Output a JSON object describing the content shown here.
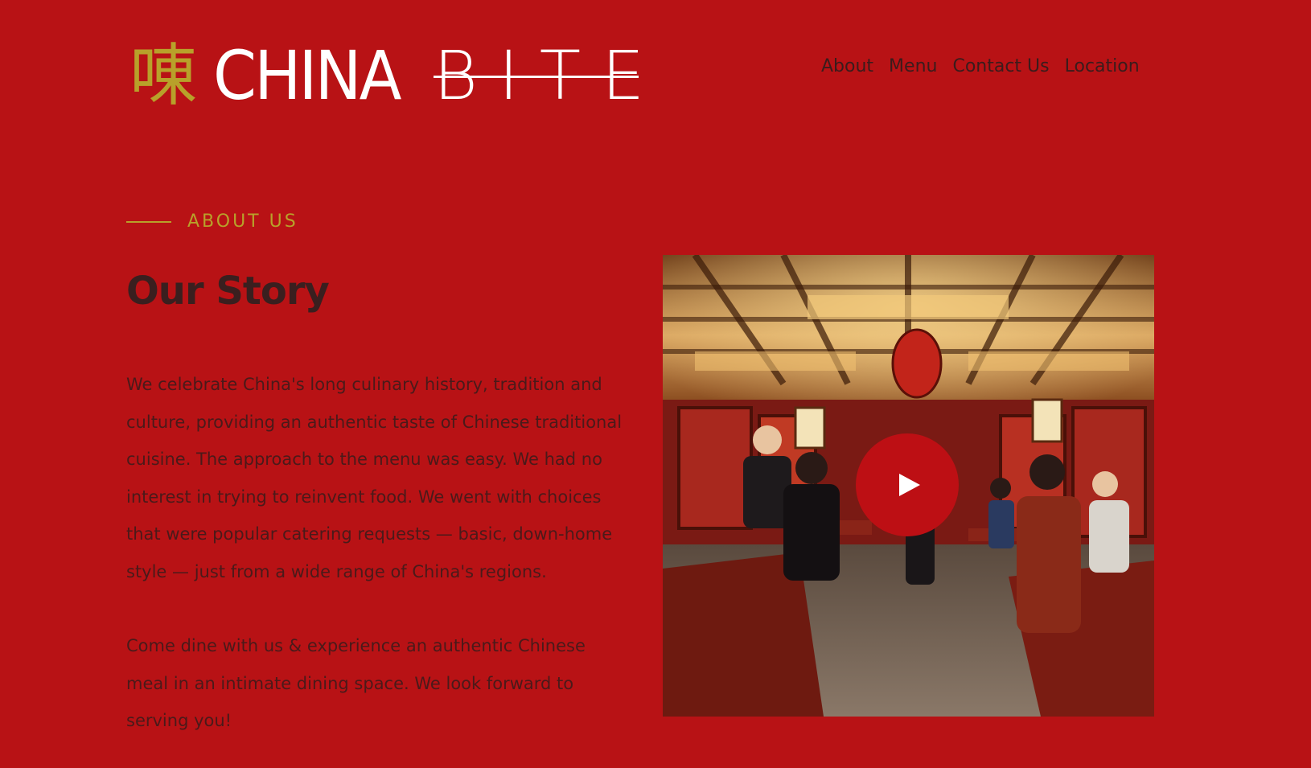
{
  "header": {
    "logo_glyph": "㖦",
    "logo_word1": "CHINA",
    "logo_word2": "BITE",
    "nav": [
      {
        "label": "About"
      },
      {
        "label": "Menu"
      },
      {
        "label": "Contact Us"
      },
      {
        "label": "Location"
      }
    ]
  },
  "about": {
    "eyebrow": "ABOUT US",
    "title": "Our Story",
    "paragraphs": [
      "We celebrate China's long culinary history, tradition and culture, providing an authentic taste of Chinese traditional cuisine. The approach to the menu was easy. We had no interest in trying to reinvent food. We went with choices that were popular catering requests — basic, down-home style — just from a wide range of China's regions.",
      "Come dine with us & experience an authentic Chinese meal in an intimate dining space. We look forward to serving you!"
    ]
  },
  "media": {
    "play_icon": "play-icon"
  },
  "colors": {
    "background": "#b81215",
    "accent_gold": "#b8a12a",
    "text_dark": "#3a1f1f",
    "play_button": "#bd0f14"
  }
}
